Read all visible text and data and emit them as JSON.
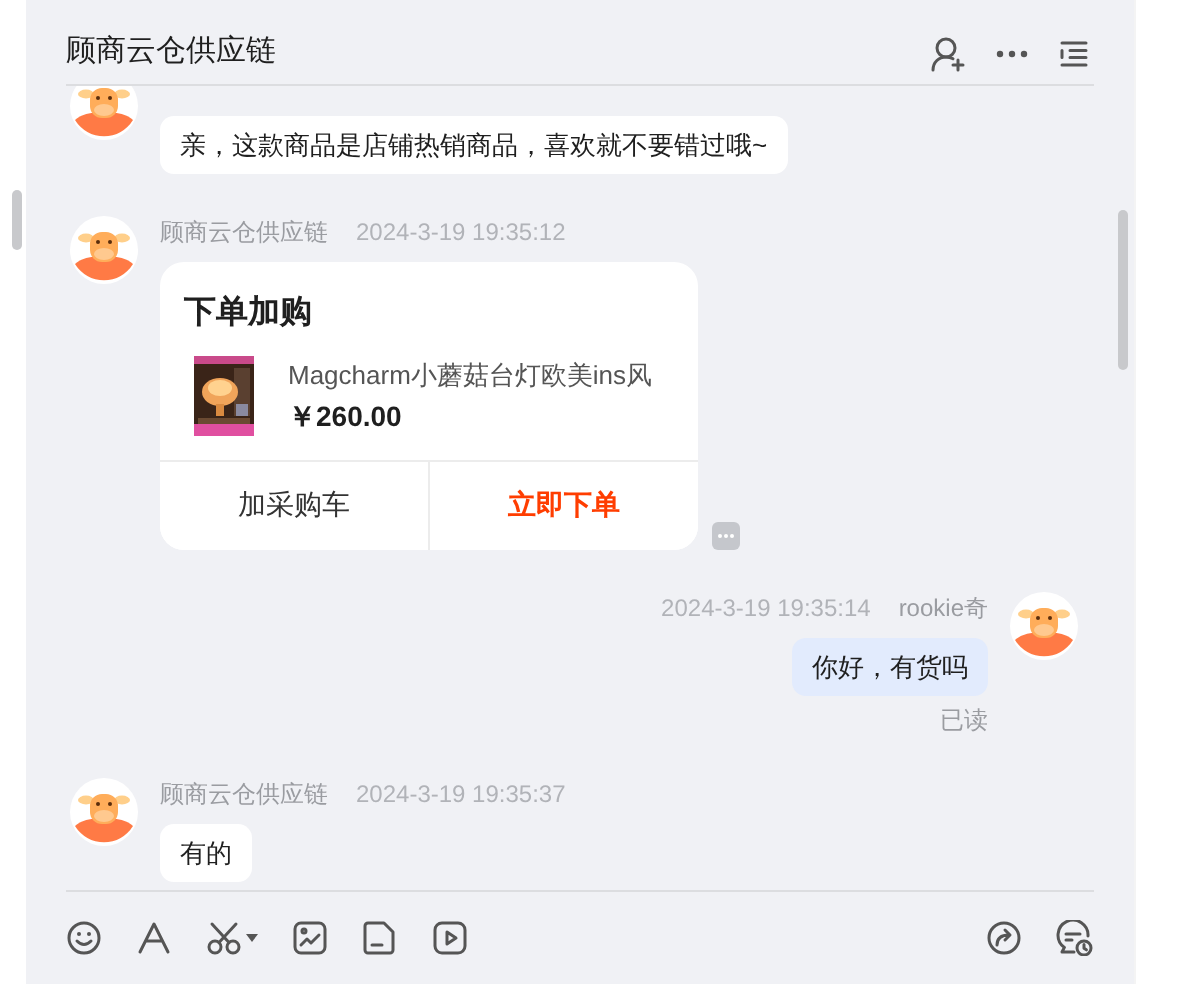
{
  "header": {
    "title": "顾商云仓供应链"
  },
  "messages": [
    {
      "kind": "text",
      "outgoing": false,
      "text": "亲，这款商品是店铺热销商品，喜欢就不要错过哦~"
    },
    {
      "kind": "order_card",
      "outgoing": false,
      "sender": "顾商云仓供应链",
      "time": "2024-3-19 19:35:12",
      "card": {
        "title": "下单加购",
        "product_name": "Magcharm小蘑菇台灯欧美ins风",
        "price": "￥260.00",
        "buttons": [
          {
            "label": "加采购车",
            "primary": false
          },
          {
            "label": "立即下单",
            "primary": true
          }
        ]
      }
    },
    {
      "kind": "text",
      "outgoing": true,
      "sender": "rookie奇",
      "time": "2024-3-19 19:35:14",
      "text": "你好，有货吗",
      "receipt": "已读"
    },
    {
      "kind": "text",
      "outgoing": false,
      "sender": "顾商云仓供应链",
      "time": "2024-3-19 19:35:37",
      "text": "有的"
    }
  ]
}
